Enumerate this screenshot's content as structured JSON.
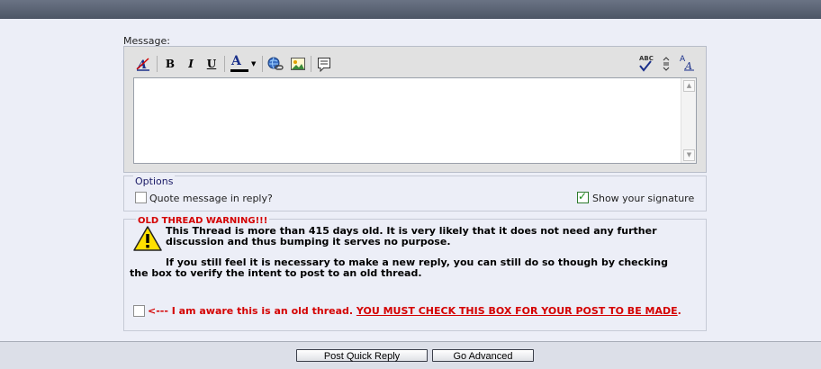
{
  "form": {
    "message_label": "Message:"
  },
  "toolbar": {
    "buttons": [
      {
        "name": "remove-format",
        "icon": "remove-format-icon"
      },
      {
        "name": "bold",
        "glyph": "B"
      },
      {
        "name": "italic",
        "glyph": "I"
      },
      {
        "name": "underline",
        "glyph": "U"
      },
      {
        "name": "font-color",
        "glyph": "A"
      },
      {
        "name": "insert-link",
        "icon": "link-icon"
      },
      {
        "name": "insert-image",
        "icon": "image-icon"
      },
      {
        "name": "insert-quote",
        "icon": "quote-icon"
      },
      {
        "name": "spell-check",
        "glyph": "ABC"
      },
      {
        "name": "resize",
        "icon": "resize-icon"
      },
      {
        "name": "switch-mode",
        "glyph": "A"
      }
    ]
  },
  "options": {
    "legend": "Options",
    "quote_label": "Quote message in reply?",
    "quote_checked": false,
    "signature_label": "Show your signature",
    "signature_checked": true
  },
  "warning": {
    "title": "OLD THREAD WARNING!!!",
    "line1": "This Thread is more than 415 days old. It is very likely that it does not need any further discussion and thus bumping it serves no purpose.",
    "line2": "If you still feel it is necessary to make a new reply, you can still do so though by checking the box to verify the intent to post to an old thread.",
    "aware_prefix": "<--- I am aware this is an old thread. ",
    "aware_emphasis": "YOU MUST CHECK THIS BOX FOR YOUR POST TO BE MADE",
    "aware_suffix": "."
  },
  "buttons": {
    "post": "Post Quick Reply",
    "advanced": "Go Advanced"
  },
  "colors": {
    "warning_red": "#d40000",
    "background": "#eceef7"
  }
}
